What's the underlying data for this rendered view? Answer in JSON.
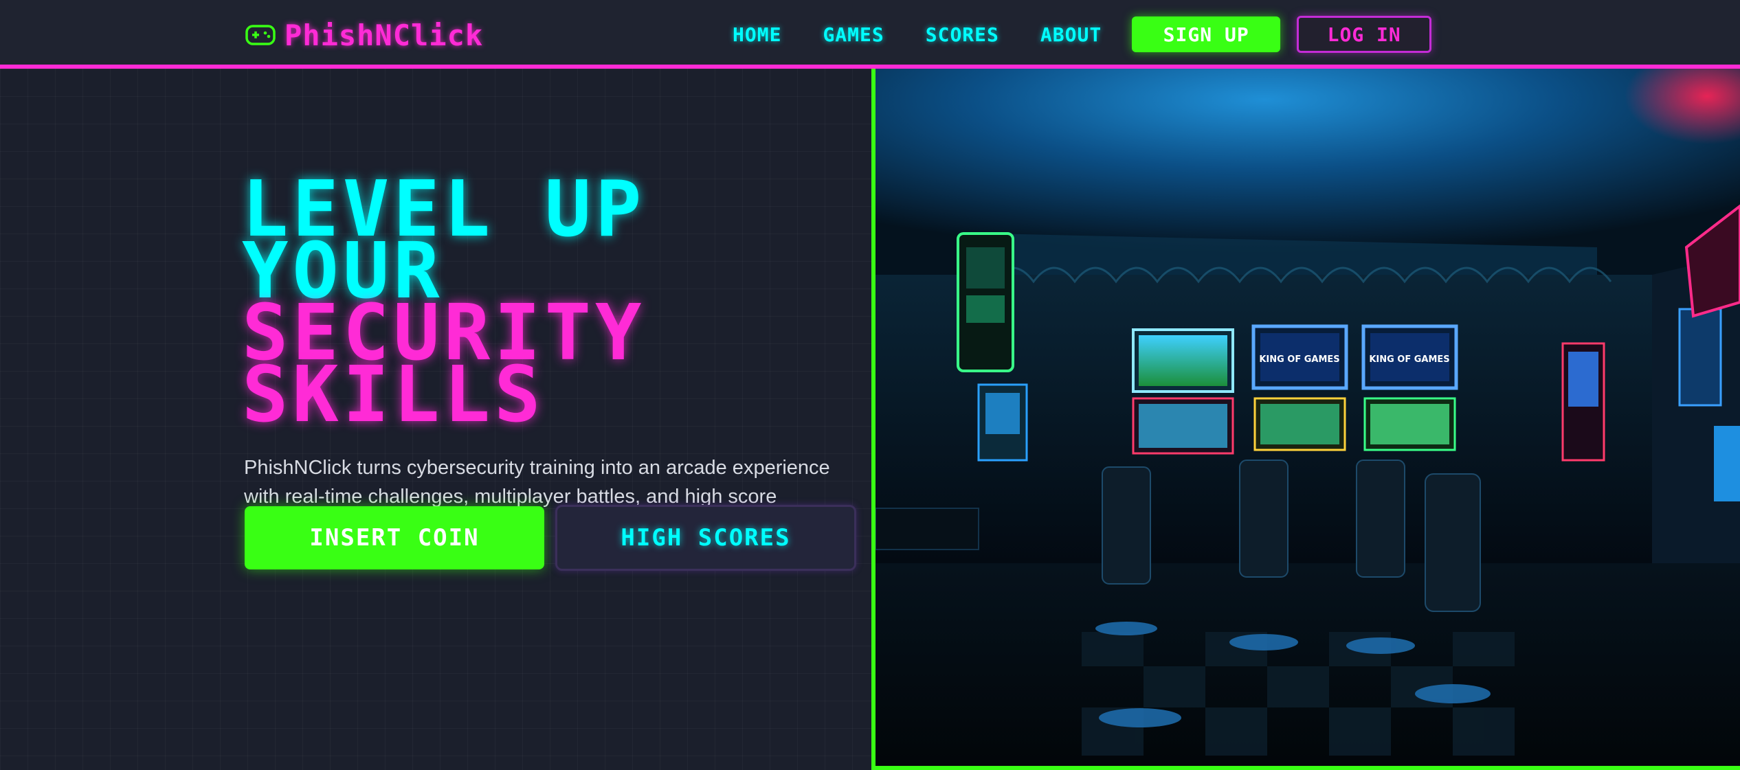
{
  "brand": {
    "name": "PhishNClick",
    "icon": "gamepad-icon"
  },
  "nav": {
    "links": [
      "HOME",
      "GAMES",
      "SCORES",
      "ABOUT"
    ],
    "signup_label": "SIGN UP",
    "login_label": "LOG IN"
  },
  "hero": {
    "headline_lines": [
      "LEVEL UP",
      "YOUR",
      "SECURITY",
      "SKILLS"
    ],
    "description": "PhishNClick turns cybersecurity training into an arcade experience with real-time challenges, multiplayer battles, and high score boards.",
    "primary_cta": "INSERT COIN",
    "secondary_cta": "HIGH SCORES",
    "image": {
      "alt": "Neon arcade room with game cabinets",
      "cabinet_screen_texts": [
        "KING OF GAMES",
        "KING OF GAMES"
      ]
    }
  },
  "colors": {
    "background": "#1a1d29",
    "navbar": "#1f2330",
    "neon_cyan": "#00ffff",
    "neon_magenta": "#ff2bd6",
    "neon_green": "#39ff14",
    "text_light": "#d8dbe3"
  }
}
